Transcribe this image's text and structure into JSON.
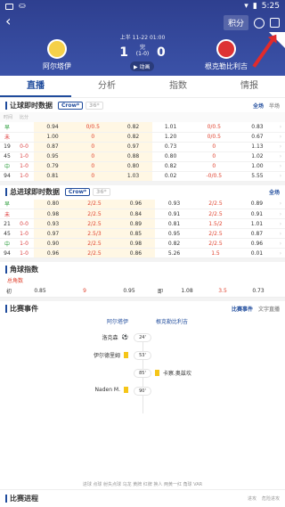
{
  "status": {
    "left_icons": [
      "notification-icon",
      "app-icon",
      "wifi-icon"
    ],
    "time": "5:25"
  },
  "header": {
    "jifen": "积分",
    "league": "上半   11-22 01:00",
    "home": "阿尔塔伊",
    "away": "根克勒比利吉",
    "score_home": "1",
    "score_away": "0",
    "half_label": "完",
    "half_score": "(1-0)",
    "anim": "▶ 动画"
  },
  "tabs": [
    "直播",
    "分析",
    "指数",
    "情报"
  ],
  "handicap": {
    "title": "让球即时数据",
    "crow": "Crow*",
    "c36": "36*",
    "scope_all": "全场",
    "scope_half": "半场",
    "cols": [
      "时间",
      "比分",
      "",
      "",
      "",
      "",
      "",
      ""
    ],
    "rows": [
      [
        "早",
        "",
        "0.94",
        "0/0.5",
        "0.82",
        "1.01",
        "0/0.5",
        "0.83"
      ],
      [
        "未",
        "",
        "1.00",
        "0",
        "0.82",
        "1.20",
        "0/0.5",
        "0.67"
      ],
      [
        "19",
        "0-0",
        "0.87",
        "0",
        "0.97",
        "0.73",
        "0",
        "1.13"
      ],
      [
        "45",
        "1-0",
        "0.95",
        "0",
        "0.88",
        "0.80",
        "0",
        "1.02"
      ],
      [
        "中",
        "1-0",
        "0.79",
        "0",
        "0.80",
        "0.82",
        "0",
        "1.00"
      ],
      [
        "94",
        "1-0",
        "0.81",
        "0",
        "1.03",
        "0.02",
        "-0/0.5",
        "5.55"
      ]
    ]
  },
  "total": {
    "title": "总进球即时数据",
    "crow": "Crow*",
    "c36": "36*",
    "scope_all": "全场",
    "rows": [
      [
        "早",
        "",
        "0.80",
        "2/2.5",
        "0.96",
        "0.93",
        "2/2.5",
        "0.89"
      ],
      [
        "未",
        "",
        "0.98",
        "2/2.5",
        "0.84",
        "0.91",
        "2/2.5",
        "0.91"
      ],
      [
        "21",
        "0-0",
        "0.93",
        "2/2.5",
        "0.89",
        "0.81",
        "1.5/2",
        "1.01"
      ],
      [
        "45",
        "1-0",
        "0.97",
        "2.5/3",
        "0.85",
        "0.95",
        "2/2.5",
        "0.87"
      ],
      [
        "中",
        "1-0",
        "0.90",
        "2/2.5",
        "0.98",
        "0.82",
        "2/2.5",
        "0.96"
      ],
      [
        "94",
        "1-0",
        "0.96",
        "2/2.5",
        "0.86",
        "5.26",
        "1.5",
        "0.01"
      ]
    ]
  },
  "corner": {
    "title": "角球指数",
    "sub": "总角数",
    "row": [
      "初",
      "0.85",
      "9",
      "0.95",
      "即",
      "1.08",
      "3.5",
      "0.73"
    ]
  },
  "events": {
    "title": "比赛事件",
    "tab1": "比赛事件",
    "tab2": "文字直播",
    "home": "阿尔塔伊",
    "away": "根克勒比利吉",
    "items": [
      {
        "side": "home",
        "name": "洛克森",
        "min": "24'",
        "icon": "goal-icon"
      },
      {
        "side": "home",
        "name": "伊尔德里姆",
        "min": "53'",
        "icon": "yellow-card-icon"
      },
      {
        "side": "away",
        "name": "卡察.奥兹坎",
        "min": "85'",
        "icon": "yellow-card-icon"
      },
      {
        "side": "home",
        "name": "Naden M.",
        "min": "90'",
        "icon": "yellow-card-icon"
      }
    ],
    "legend": "进球  点球  射失点球  乌龙  黄牌  红牌  换人  两黄一红  角球  VAR"
  },
  "bottom": {
    "title": "比赛进程",
    "tag1": "进攻",
    "tag2": "危险进攻"
  }
}
